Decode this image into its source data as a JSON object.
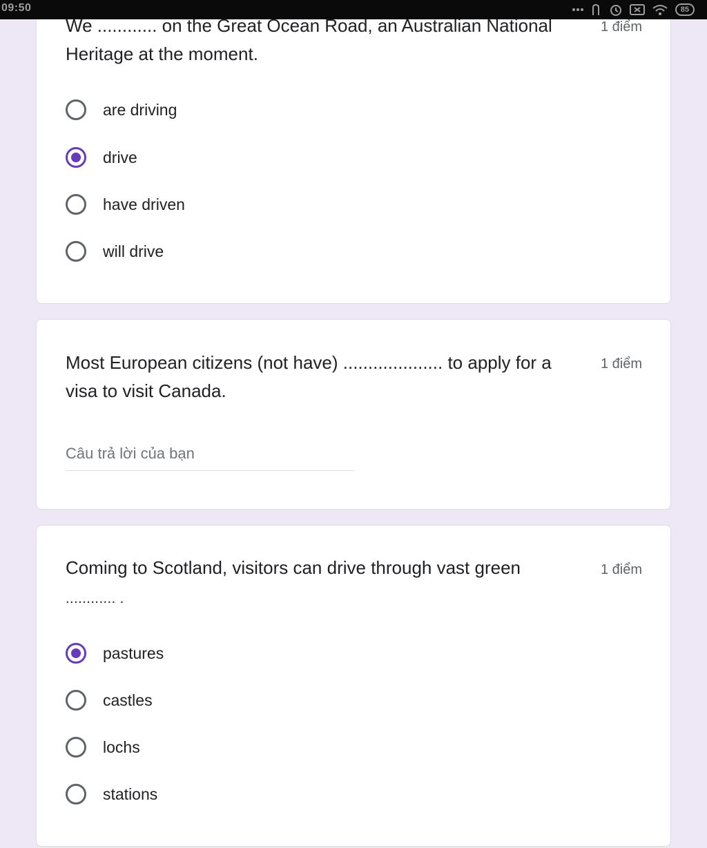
{
  "status_bar": {
    "time": "09:50",
    "icons": [
      "more-icon",
      "signal-icon",
      "alarm-icon",
      "notification-icon",
      "wifi-icon"
    ],
    "battery": "85"
  },
  "questions": [
    {
      "text": "We ............ on the Great Ocean Road, an Australian National Heritage at the moment.",
      "points": "1 điểm",
      "options": [
        {
          "label": "are driving",
          "selected": false
        },
        {
          "label": "drive",
          "selected": true
        },
        {
          "label": "have driven",
          "selected": false
        },
        {
          "label": "will drive",
          "selected": false
        }
      ]
    },
    {
      "text": "Most European citizens (not have) .................... to apply for a visa to visit Canada.",
      "points": "1 điểm",
      "answer": {
        "value": "",
        "placeholder": "Câu trả lời của bạn"
      }
    },
    {
      "text_line1": "Coming to Scotland, visitors can drive through vast green",
      "text_line2": "............ .",
      "points": "1 điểm",
      "options": [
        {
          "label": "pastures",
          "selected": true
        },
        {
          "label": "castles",
          "selected": false
        },
        {
          "label": "lochs",
          "selected": false
        },
        {
          "label": "stations",
          "selected": false
        }
      ]
    }
  ],
  "colors": {
    "accent": "#673ab7",
    "background": "#ede7f6",
    "radio_off": "#5f6368"
  }
}
